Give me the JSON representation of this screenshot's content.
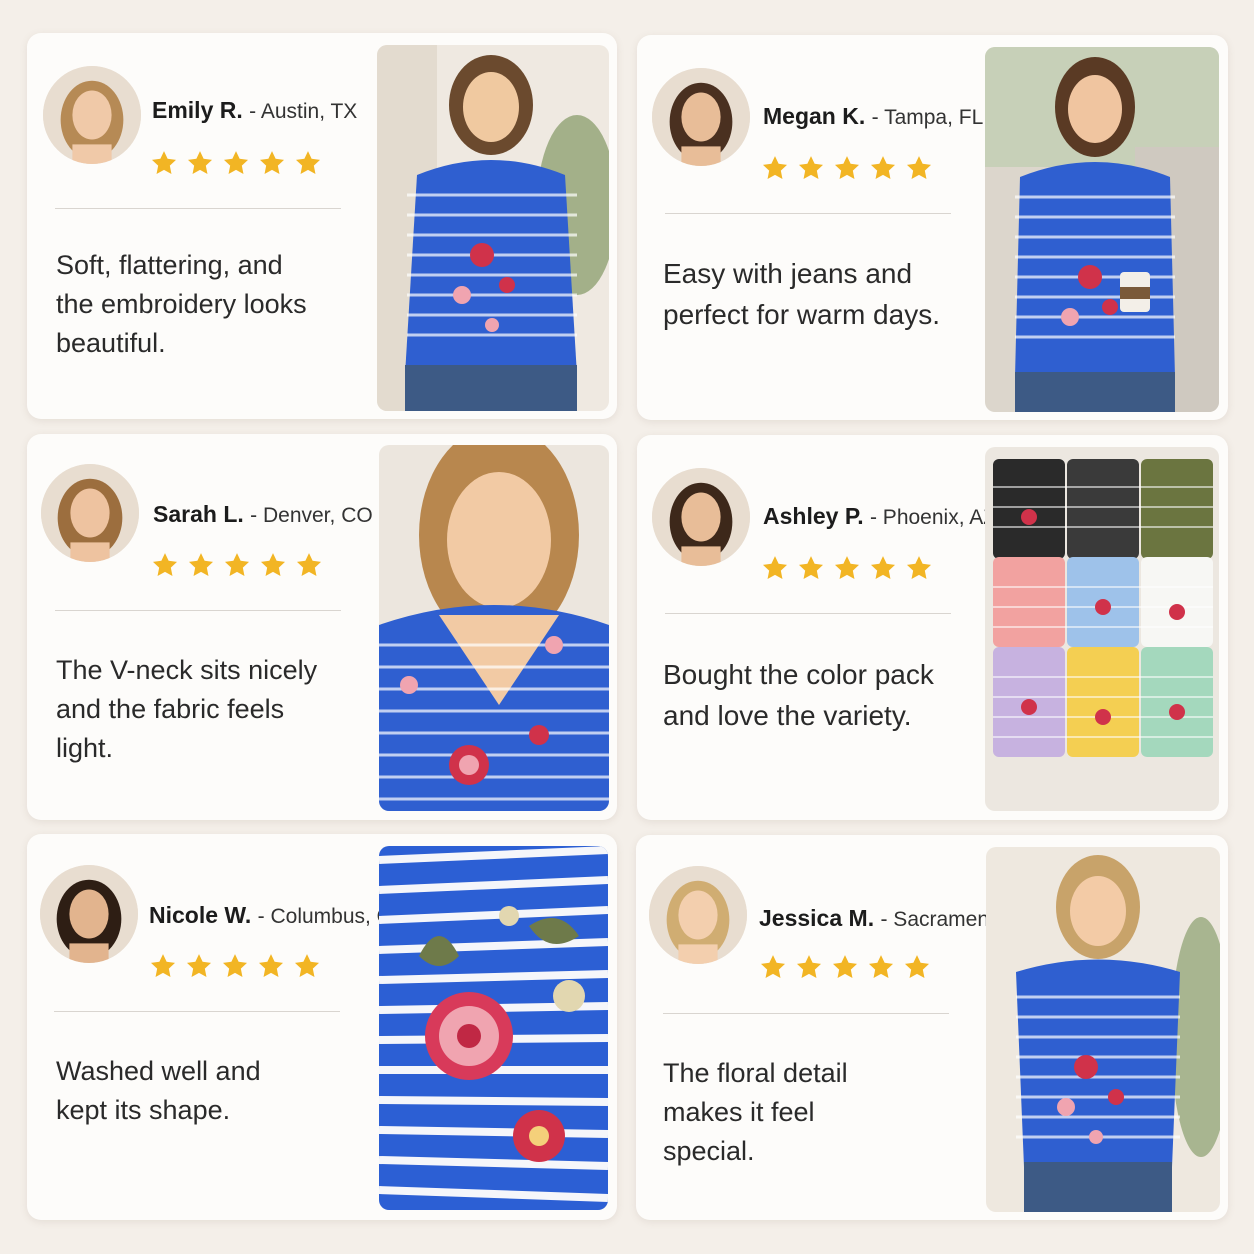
{
  "colors": {
    "background": "#f4efe9",
    "card": "#fdfcfa",
    "star": "#f2b524",
    "shirt_blue": "#2f5fd0",
    "stripe": "#ffffff",
    "flower_red": "#d0324a",
    "flower_pink": "#f0a4b0"
  },
  "icons": {
    "rating": "star-icon"
  },
  "reviews": [
    {
      "name": "Emily R.",
      "location": "- Austin, TX",
      "rating": 5,
      "text": "Soft, flattering, and the embroidery looks beautiful.",
      "photo": "woman-in-striped-embroidered-tee"
    },
    {
      "name": "Megan K.",
      "location": "- Tampa, FL",
      "rating": 5,
      "text": "Easy with jeans and perfect for warm days.",
      "photo": "woman-walking-with-coffee"
    },
    {
      "name": "Sarah L.",
      "location": "- Denver, CO",
      "rating": 5,
      "text": "The V-neck sits nicely and the fabric feels light.",
      "photo": "neckline-closeup"
    },
    {
      "name": "Ashley P.",
      "location": "- Phoenix, AZ",
      "rating": 5,
      "text": "Bought the color pack and love the variety.",
      "photo": "folded-color-pack"
    },
    {
      "name": "Nicole W.",
      "location": "- Columbus, OH",
      "rating": 5,
      "text": "Washed well and kept its shape.",
      "photo": "embroidery-fabric-closeup"
    },
    {
      "name": "Jessica M.",
      "location": "- Sacramento, CA",
      "rating": 5,
      "text": "The floral detail makes it feel special.",
      "photo": "woman-in-striped-embroidered-tee"
    }
  ]
}
